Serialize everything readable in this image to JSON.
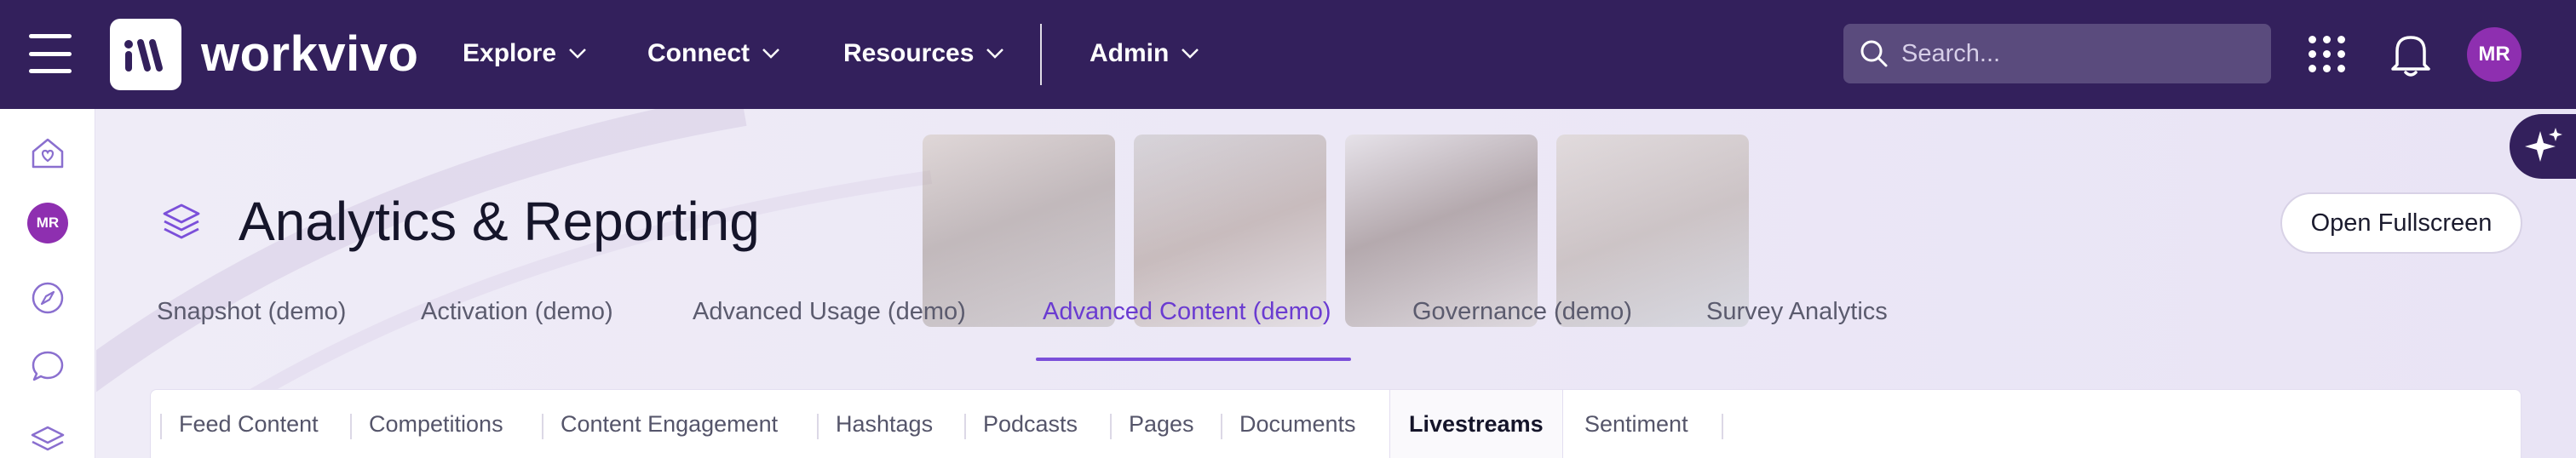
{
  "header": {
    "logo_text": "workvivo",
    "nav": [
      {
        "label": "Explore"
      },
      {
        "label": "Connect"
      },
      {
        "label": "Resources"
      },
      {
        "label": "Admin"
      }
    ],
    "search_placeholder": "Search...",
    "user_initials": "MR"
  },
  "rail": {
    "user_initials": "MR"
  },
  "page": {
    "title": "Analytics & Reporting",
    "open_fullscreen_label": "Open Fullscreen"
  },
  "tabs": [
    {
      "label": "Snapshot (demo)"
    },
    {
      "label": "Activation (demo)"
    },
    {
      "label": "Advanced Usage (demo)"
    },
    {
      "label": "Advanced Content (demo)",
      "active": true
    },
    {
      "label": "Governance (demo)"
    },
    {
      "label": "Survey Analytics"
    }
  ],
  "subtabs": [
    {
      "label": "Feed Content"
    },
    {
      "label": "Competitions"
    },
    {
      "label": "Content Engagement"
    },
    {
      "label": "Hashtags"
    },
    {
      "label": "Podcasts"
    },
    {
      "label": "Pages"
    },
    {
      "label": "Documents"
    },
    {
      "label": "Livestreams",
      "active": true
    },
    {
      "label": "Sentiment"
    }
  ],
  "colors": {
    "header_bg": "#33205c",
    "accent": "#7b4fd9",
    "avatar": "#8e2fb0"
  }
}
